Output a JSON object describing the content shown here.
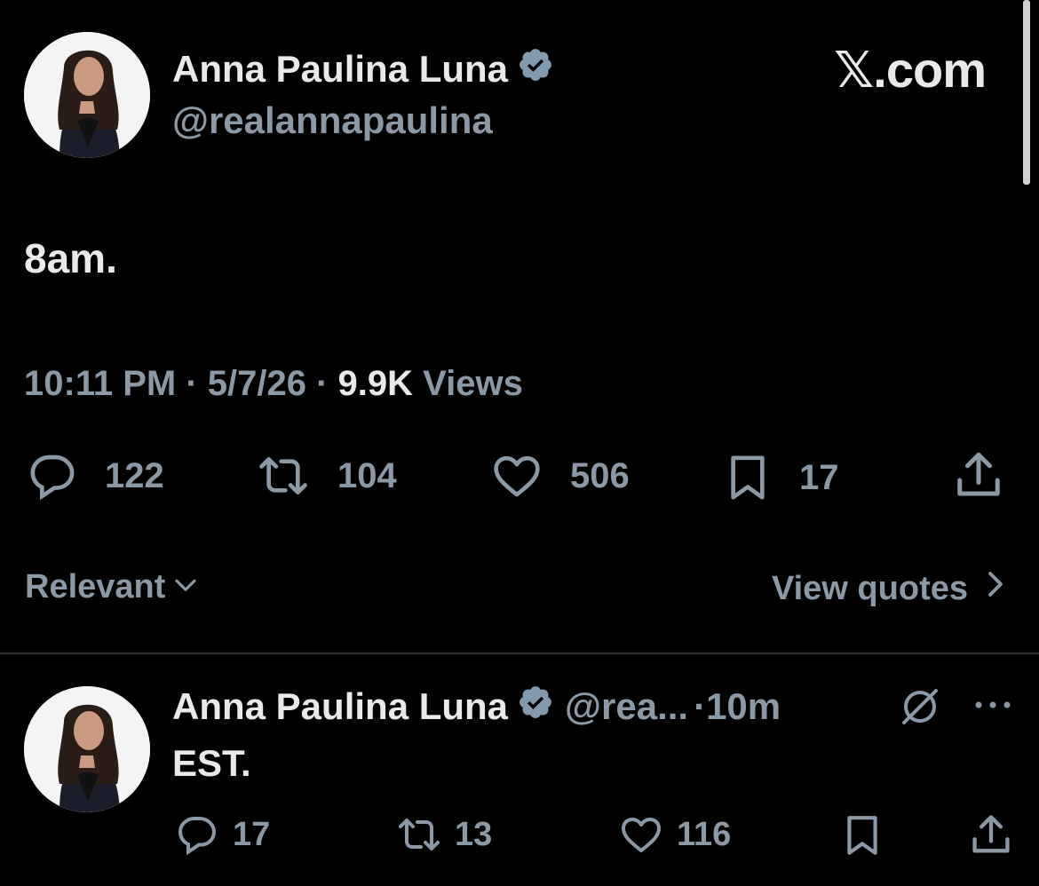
{
  "main_tweet": {
    "author_name": "Anna Paulina Luna",
    "handle": "@realannapaulina",
    "text": "8am.",
    "time": "10:11 PM",
    "date": "5/7/26",
    "views_count": "9.9K",
    "views_label": "Views",
    "replies": "122",
    "reposts": "104",
    "likes": "506",
    "bookmarks": "17"
  },
  "brand": {
    "x_logo": "𝕏",
    "domain": ".com"
  },
  "sort_bar": {
    "relevant_label": "Relevant",
    "view_quotes_label": "View quotes"
  },
  "reply": {
    "author_name": "Anna Paulina Luna",
    "handle_truncated": "@rea...",
    "separator": "·",
    "time_ago": "10m",
    "text": "EST.",
    "replies": "17",
    "reposts": "13",
    "likes": "116"
  },
  "colors": {
    "background": "#000000",
    "text": "#e7e9ea",
    "muted": "#8b98a5",
    "verified_badge": "#829aab",
    "divider": "#2f3336"
  },
  "icons": [
    "verified-badge-icon",
    "reply-icon",
    "repost-icon",
    "like-icon",
    "bookmark-icon",
    "share-icon",
    "chevron-down-icon",
    "chevron-right-icon",
    "grok-icon",
    "more-icon"
  ]
}
